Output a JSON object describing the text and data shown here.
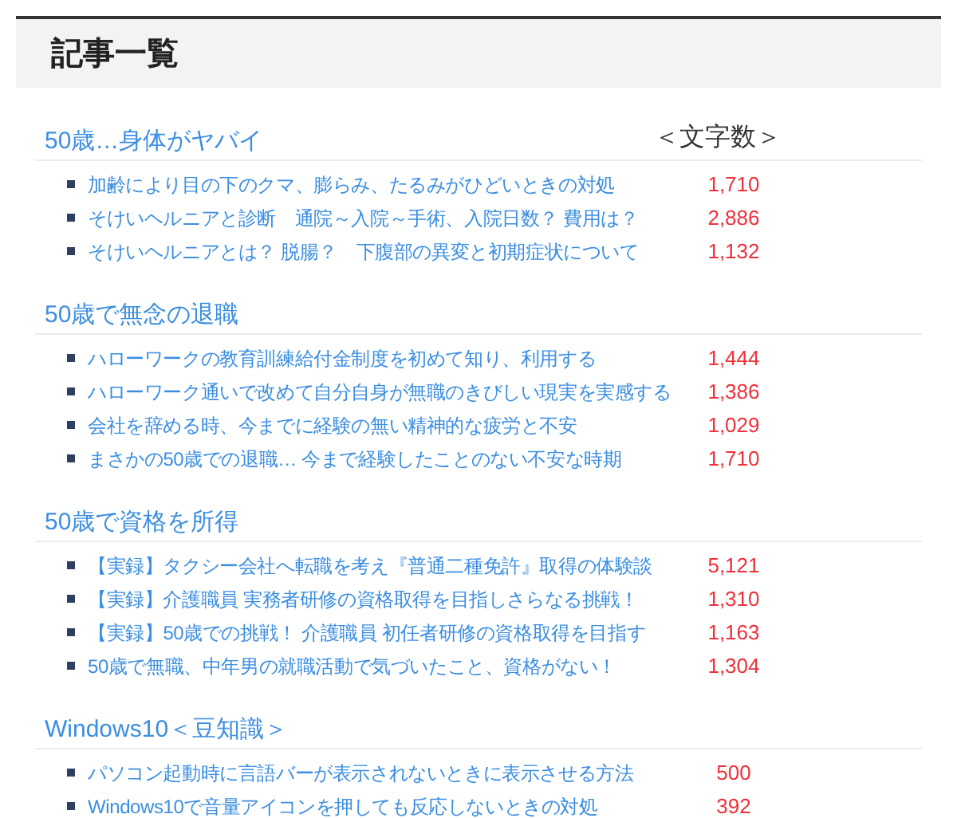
{
  "page_title": "記事一覧",
  "count_label": "＜文字数＞",
  "sections": [
    {
      "heading": "50歳…身体がヤバイ",
      "articles": [
        {
          "title": "加齢により目の下のクマ、膨らみ、たるみがひどいときの対処",
          "count": "1,710"
        },
        {
          "title": "そけいヘルニアと診断　通院～入院～手術、入院日数？ 費用は？",
          "count": "2,886"
        },
        {
          "title": "そけいヘルニアとは？ 脱腸？　下腹部の異変と初期症状について",
          "count": "1,132"
        }
      ]
    },
    {
      "heading": "50歳で無念の退職",
      "articles": [
        {
          "title": "ハローワークの教育訓練給付金制度を初めて知り、利用する",
          "count": "1,444"
        },
        {
          "title": "ハローワーク通いで改めて自分自身が無職のきびしい現実を実感する",
          "count": "1,386"
        },
        {
          "title": "会社を辞める時、今までに経験の無い精神的な疲労と不安",
          "count": "1,029"
        },
        {
          "title": "まさかの50歳での退職… 今まで経験したことのない不安な時期",
          "count": "1,710"
        }
      ]
    },
    {
      "heading": "50歳で資格を所得",
      "articles": [
        {
          "title": "【実録】タクシー会社へ転職を考え『普通二種免許』取得の体験談",
          "count": "5,121"
        },
        {
          "title": "【実録】介護職員 実務者研修の資格取得を目指しさらなる挑戦！",
          "count": "1,310"
        },
        {
          "title": "【実録】50歳での挑戦！ 介護職員 初任者研修の資格取得を目指す",
          "count": "1,163"
        },
        {
          "title": "50歳で無職、中年男の就職活動で気づいたこと、資格がない！",
          "count": "1,304"
        }
      ]
    },
    {
      "heading": "Windows10＜豆知識＞",
      "articles": [
        {
          "title": "パソコン起動時に言語バーが表示されないときに表示させる方法",
          "count": "500"
        },
        {
          "title": "Windows10で音量アイコンを押しても反応しないときの対処",
          "count": "392"
        }
      ]
    }
  ]
}
